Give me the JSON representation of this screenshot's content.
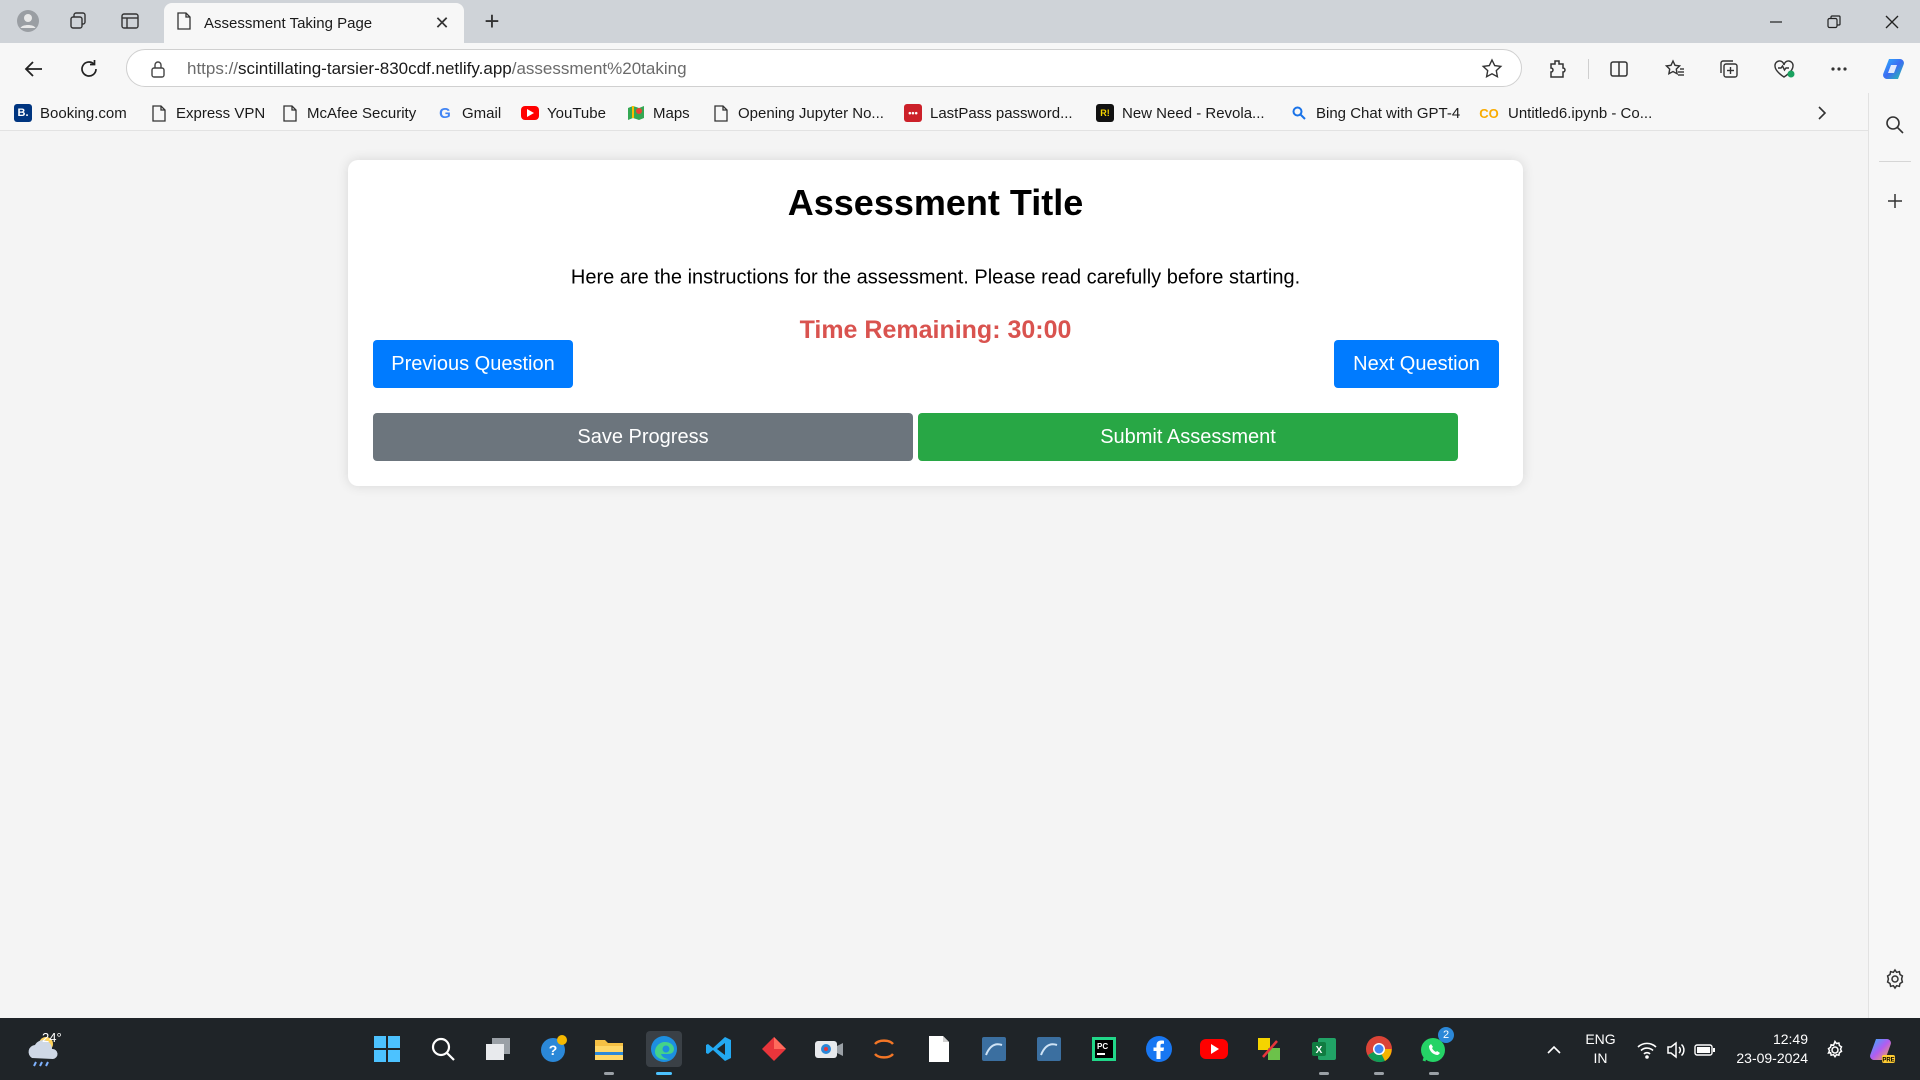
{
  "browser": {
    "tab_title": "Assessment Taking Page",
    "url_scheme": "https://",
    "url_host": "scintillating-tarsier-830cdf.netlify.app",
    "url_path": "/assessment%20taking"
  },
  "bookmarks": [
    {
      "label": "Booking.com",
      "icon": "booking-icon"
    },
    {
      "label": "Express VPN",
      "icon": "page-icon"
    },
    {
      "label": "McAfee Security",
      "icon": "page-icon"
    },
    {
      "label": "Gmail",
      "icon": "google-icon"
    },
    {
      "label": "YouTube",
      "icon": "youtube-icon"
    },
    {
      "label": "Maps",
      "icon": "maps-icon"
    },
    {
      "label": "Opening Jupyter No...",
      "icon": "page-icon"
    },
    {
      "label": "LastPass password...",
      "icon": "lastpass-icon"
    },
    {
      "label": "New Need - Revola...",
      "icon": "revola-icon"
    },
    {
      "label": "Bing Chat with GPT-4",
      "icon": "bing-search-icon"
    },
    {
      "label": "Untitled6.ipynb - Co...",
      "icon": "colab-icon"
    }
  ],
  "assessment": {
    "title": "Assessment Title",
    "instructions": "Here are the instructions for the assessment. Please read carefully before starting.",
    "timer": "Time Remaining: 30:00",
    "prev_label": "Previous Question",
    "next_label": "Next Question",
    "save_label": "Save Progress",
    "submit_label": "Submit Assessment"
  },
  "colors": {
    "primary": "#007bff",
    "secondary": "#6c757d",
    "success": "#28a745",
    "timer": "#d9534f"
  },
  "taskbar": {
    "weather_temp": "24°",
    "lang_line1": "ENG",
    "lang_line2": "IN",
    "time": "12:49",
    "date": "23-09-2024",
    "whatsapp_badge": "2"
  }
}
